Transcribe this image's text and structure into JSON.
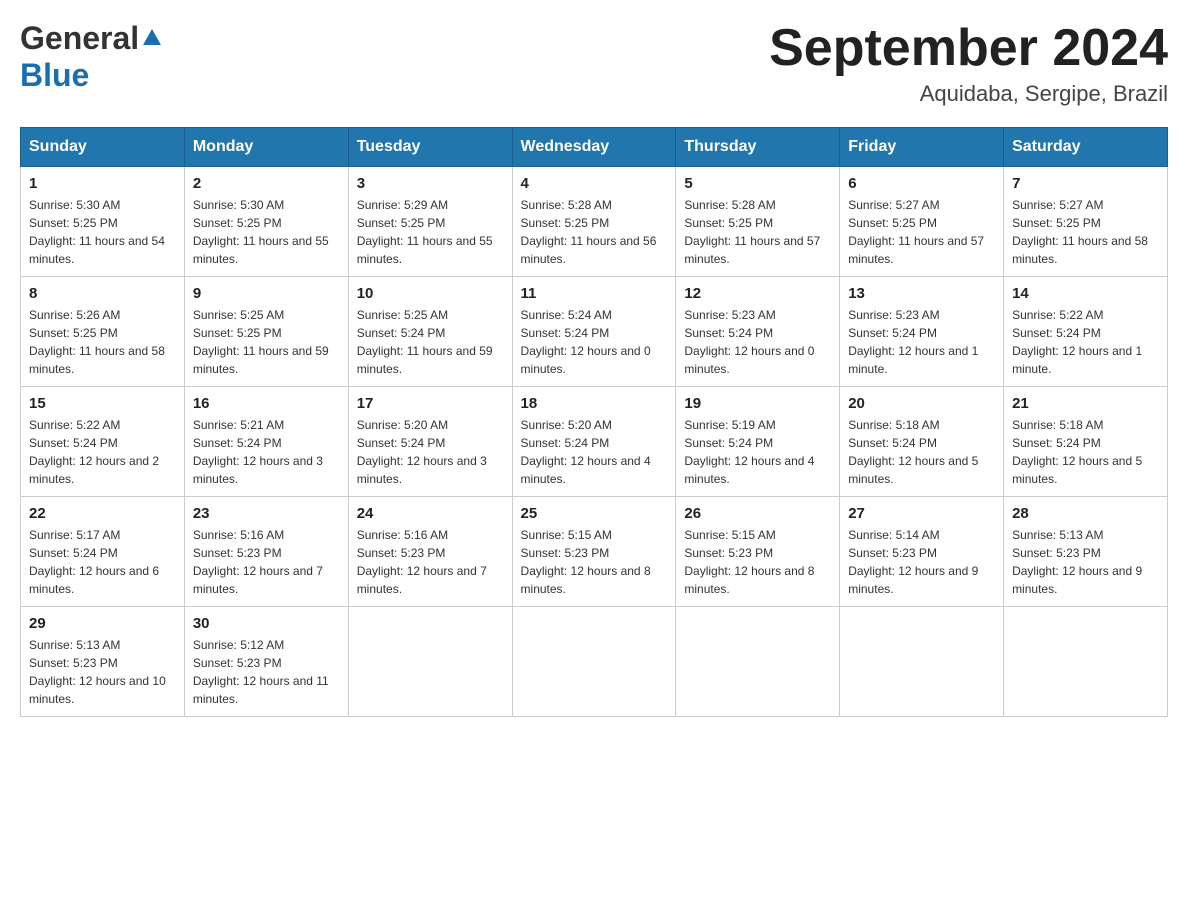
{
  "header": {
    "logo_general": "General",
    "logo_blue": "Blue",
    "title": "September 2024",
    "subtitle": "Aquidaba, Sergipe, Brazil"
  },
  "days_of_week": [
    "Sunday",
    "Monday",
    "Tuesday",
    "Wednesday",
    "Thursday",
    "Friday",
    "Saturday"
  ],
  "weeks": [
    [
      {
        "day": "1",
        "sunrise": "5:30 AM",
        "sunset": "5:25 PM",
        "daylight": "11 hours and 54 minutes."
      },
      {
        "day": "2",
        "sunrise": "5:30 AM",
        "sunset": "5:25 PM",
        "daylight": "11 hours and 55 minutes."
      },
      {
        "day": "3",
        "sunrise": "5:29 AM",
        "sunset": "5:25 PM",
        "daylight": "11 hours and 55 minutes."
      },
      {
        "day": "4",
        "sunrise": "5:28 AM",
        "sunset": "5:25 PM",
        "daylight": "11 hours and 56 minutes."
      },
      {
        "day": "5",
        "sunrise": "5:28 AM",
        "sunset": "5:25 PM",
        "daylight": "11 hours and 57 minutes."
      },
      {
        "day": "6",
        "sunrise": "5:27 AM",
        "sunset": "5:25 PM",
        "daylight": "11 hours and 57 minutes."
      },
      {
        "day": "7",
        "sunrise": "5:27 AM",
        "sunset": "5:25 PM",
        "daylight": "11 hours and 58 minutes."
      }
    ],
    [
      {
        "day": "8",
        "sunrise": "5:26 AM",
        "sunset": "5:25 PM",
        "daylight": "11 hours and 58 minutes."
      },
      {
        "day": "9",
        "sunrise": "5:25 AM",
        "sunset": "5:25 PM",
        "daylight": "11 hours and 59 minutes."
      },
      {
        "day": "10",
        "sunrise": "5:25 AM",
        "sunset": "5:24 PM",
        "daylight": "11 hours and 59 minutes."
      },
      {
        "day": "11",
        "sunrise": "5:24 AM",
        "sunset": "5:24 PM",
        "daylight": "12 hours and 0 minutes."
      },
      {
        "day": "12",
        "sunrise": "5:23 AM",
        "sunset": "5:24 PM",
        "daylight": "12 hours and 0 minutes."
      },
      {
        "day": "13",
        "sunrise": "5:23 AM",
        "sunset": "5:24 PM",
        "daylight": "12 hours and 1 minute."
      },
      {
        "day": "14",
        "sunrise": "5:22 AM",
        "sunset": "5:24 PM",
        "daylight": "12 hours and 1 minute."
      }
    ],
    [
      {
        "day": "15",
        "sunrise": "5:22 AM",
        "sunset": "5:24 PM",
        "daylight": "12 hours and 2 minutes."
      },
      {
        "day": "16",
        "sunrise": "5:21 AM",
        "sunset": "5:24 PM",
        "daylight": "12 hours and 3 minutes."
      },
      {
        "day": "17",
        "sunrise": "5:20 AM",
        "sunset": "5:24 PM",
        "daylight": "12 hours and 3 minutes."
      },
      {
        "day": "18",
        "sunrise": "5:20 AM",
        "sunset": "5:24 PM",
        "daylight": "12 hours and 4 minutes."
      },
      {
        "day": "19",
        "sunrise": "5:19 AM",
        "sunset": "5:24 PM",
        "daylight": "12 hours and 4 minutes."
      },
      {
        "day": "20",
        "sunrise": "5:18 AM",
        "sunset": "5:24 PM",
        "daylight": "12 hours and 5 minutes."
      },
      {
        "day": "21",
        "sunrise": "5:18 AM",
        "sunset": "5:24 PM",
        "daylight": "12 hours and 5 minutes."
      }
    ],
    [
      {
        "day": "22",
        "sunrise": "5:17 AM",
        "sunset": "5:24 PM",
        "daylight": "12 hours and 6 minutes."
      },
      {
        "day": "23",
        "sunrise": "5:16 AM",
        "sunset": "5:23 PM",
        "daylight": "12 hours and 7 minutes."
      },
      {
        "day": "24",
        "sunrise": "5:16 AM",
        "sunset": "5:23 PM",
        "daylight": "12 hours and 7 minutes."
      },
      {
        "day": "25",
        "sunrise": "5:15 AM",
        "sunset": "5:23 PM",
        "daylight": "12 hours and 8 minutes."
      },
      {
        "day": "26",
        "sunrise": "5:15 AM",
        "sunset": "5:23 PM",
        "daylight": "12 hours and 8 minutes."
      },
      {
        "day": "27",
        "sunrise": "5:14 AM",
        "sunset": "5:23 PM",
        "daylight": "12 hours and 9 minutes."
      },
      {
        "day": "28",
        "sunrise": "5:13 AM",
        "sunset": "5:23 PM",
        "daylight": "12 hours and 9 minutes."
      }
    ],
    [
      {
        "day": "29",
        "sunrise": "5:13 AM",
        "sunset": "5:23 PM",
        "daylight": "12 hours and 10 minutes."
      },
      {
        "day": "30",
        "sunrise": "5:12 AM",
        "sunset": "5:23 PM",
        "daylight": "12 hours and 11 minutes."
      },
      null,
      null,
      null,
      null,
      null
    ]
  ],
  "labels": {
    "sunrise": "Sunrise:",
    "sunset": "Sunset:",
    "daylight": "Daylight:"
  }
}
